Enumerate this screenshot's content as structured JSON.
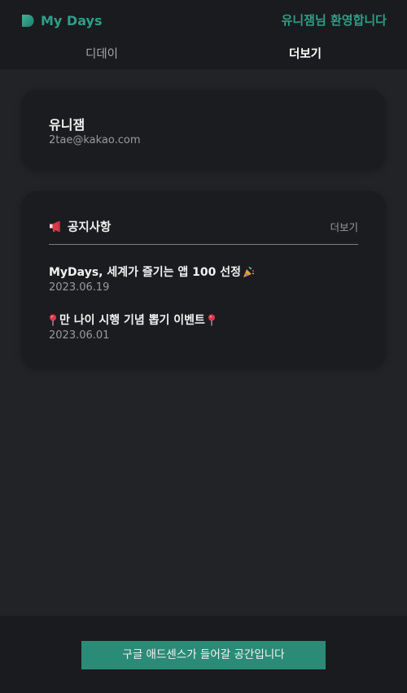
{
  "header": {
    "brand_name": "My Days",
    "welcome_text": "유니잼님 환영합니다",
    "logo_icon": "my-days-logo",
    "accent_color": "#2e9e88"
  },
  "tabs": [
    {
      "label": "디데이",
      "active": false
    },
    {
      "label": "더보기",
      "active": true
    }
  ],
  "profile": {
    "name": "유니잼",
    "email": "2tae@kakao.com"
  },
  "notices": {
    "icon": "megaphone-icon",
    "title": "공지사항",
    "more_label": "더보기",
    "items": [
      {
        "title": "MyDays, 세계가 즐기는 앱 100 선정",
        "trailing_icon": "party-popper-icon",
        "date": "2023.06.19"
      },
      {
        "title": "만 나이 시행 기념 뽑기 이벤트",
        "leading_icon": "pushpin-icon",
        "trailing_icon": "pushpin-icon",
        "date": "2023.06.01"
      }
    ]
  },
  "footer": {
    "ad_label": "구글 애드센스가 들어갈 공간입니다",
    "button_color": "#2a8b76"
  }
}
